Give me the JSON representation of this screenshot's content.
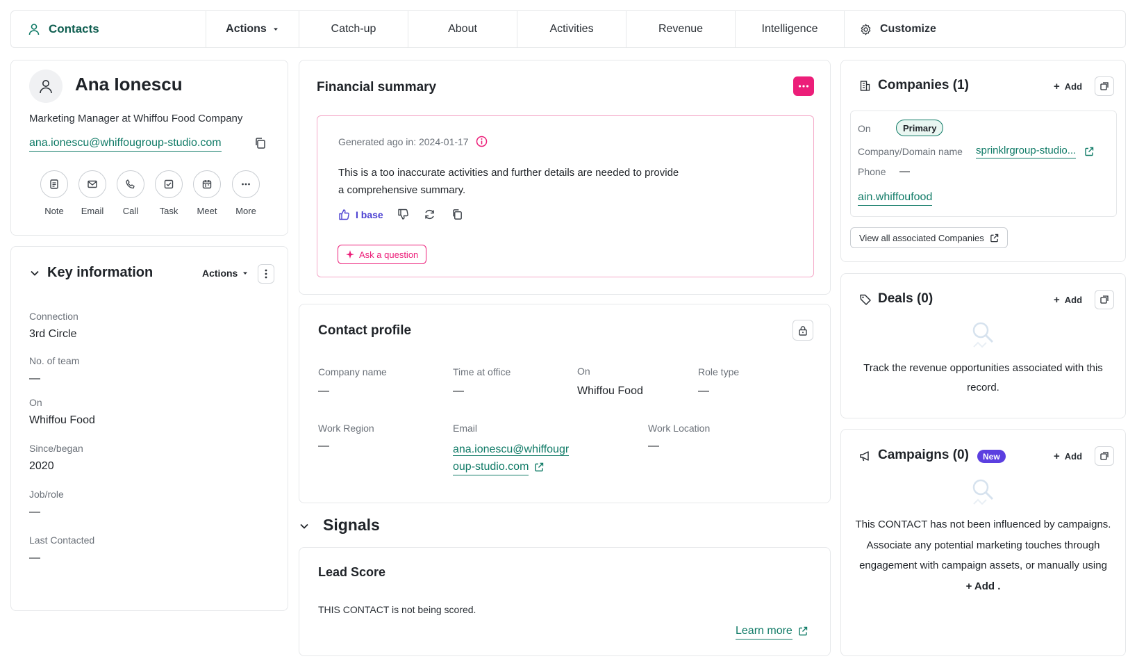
{
  "nav": {
    "contacts": "Contacts",
    "actions": "Actions",
    "tabs": [
      "Catch-up",
      "About",
      "Activities",
      "Revenue",
      "Intelligence"
    ],
    "customize": "Customize"
  },
  "contact": {
    "name": "Ana Ionescu",
    "title": "Marketing Manager at Whiffou Food Company",
    "email": "ana.ionescu@whiffougroup-studio.com",
    "actions": [
      "Note",
      "Email",
      "Call",
      "Task",
      "Meet",
      "More"
    ]
  },
  "key_info": {
    "title": "Key information",
    "actions": "Actions",
    "fields": [
      {
        "label": "Connection",
        "value": "3rd Circle"
      },
      {
        "label": "No. of team",
        "value": "—"
      },
      {
        "label": "On",
        "value": "Whiffou Food"
      },
      {
        "label": "Since/began",
        "value": "2020"
      },
      {
        "label": "Job/role",
        "value": "—"
      },
      {
        "label": "Last Contacted",
        "value": "—"
      }
    ]
  },
  "financial": {
    "title": "Financial summary",
    "generated": "Generated ago in: 2024-01-17",
    "body_line1": "This is a too inaccurate activities and further details are needed to provide",
    "body_line2": "a comprehensive summary.",
    "like": "I base",
    "ask": "Ask a question",
    "accent": "#ec1e79"
  },
  "profile": {
    "title": "Contact profile",
    "company_name_label": "Company name",
    "company_name_value": "—",
    "time_label": "Time at office",
    "time_value": "—",
    "on_label": "On",
    "on_value": "Whiffou Food",
    "role_label": "Role type",
    "role_value": "—",
    "region_label": "Work Region",
    "region_value": "—",
    "email_label": "Email",
    "email_line1": "ana.ionescu@whiffougr",
    "email_line2": "oup-studio.com",
    "location_label": "Work Location",
    "location_value": "—"
  },
  "signals": {
    "title": "Signals",
    "lead_title": "Lead Score",
    "lead_text": "THIS CONTACT is not being scored.",
    "learn_more": "Learn more"
  },
  "companies": {
    "title": "Companies (1)",
    "add": "Add",
    "on_label": "On",
    "primary": "Primary",
    "domain_label": "Company/Domain name",
    "domain_value": "sprinklrgroup-studio...",
    "phone_label": "Phone",
    "phone_value": "—",
    "link": "ain.whiffoufood",
    "view_all": "View all associated Companies"
  },
  "deals": {
    "title": "Deals (0)",
    "add": "Add",
    "empty_line1": "Track the revenue opportunities associated with this",
    "empty_line2": "record."
  },
  "campaigns": {
    "title": "Campaigns (0)",
    "badge": "New",
    "add": "Add",
    "line1": "This CONTACT has not been influenced by campaigns.",
    "line2": "Associate any potential marketing touches through",
    "line3": "engagement with campaign assets, or manually using",
    "line4": "+ Add ."
  }
}
